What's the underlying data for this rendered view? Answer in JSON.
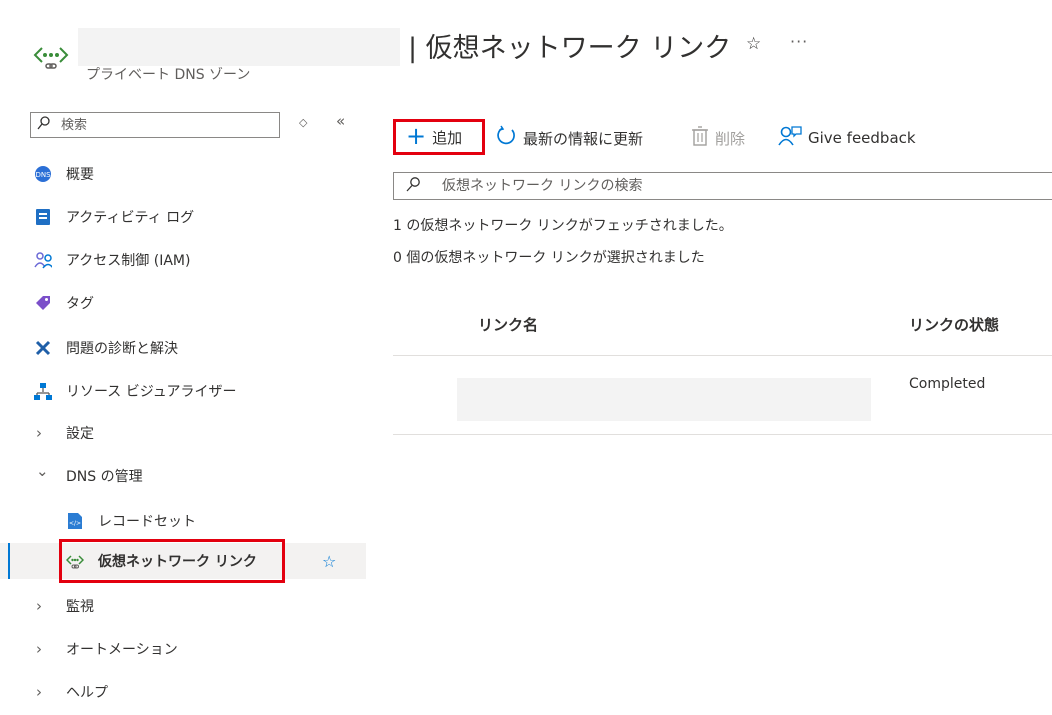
{
  "header": {
    "title": "| 仮想ネットワーク リンク",
    "subtitle": "プライベート DNS ゾーン",
    "star_glyph": "☆",
    "more_glyph": "···"
  },
  "sidebar": {
    "search_placeholder": "検索",
    "gear_glyph": "◇",
    "collapse_glyph": "«",
    "items": [
      {
        "label": "概要",
        "icon": "overview-icon"
      },
      {
        "label": "アクティビティ ログ",
        "icon": "activity-log-icon"
      },
      {
        "label": "アクセス制御 (IAM)",
        "icon": "iam-icon"
      },
      {
        "label": "タグ",
        "icon": "tag-icon"
      },
      {
        "label": "問題の診断と解決",
        "icon": "diagnose-icon"
      },
      {
        "label": "リソース ビジュアライザー",
        "icon": "resource-visualizer-icon"
      },
      {
        "label": "設定",
        "chevron": "›"
      },
      {
        "label": "DNS の管理",
        "chevron": "⌄"
      },
      {
        "label": "レコードセット",
        "icon": "record-set-icon"
      },
      {
        "label": "仮想ネットワーク リンク",
        "icon": "virtual-network-link-icon",
        "favorite": "☆"
      },
      {
        "label": "監視",
        "chevron": "›"
      },
      {
        "label": "オートメーション",
        "chevron": "›"
      },
      {
        "label": "ヘルプ",
        "chevron": "›"
      }
    ]
  },
  "toolbar": {
    "add_label": "追加",
    "add_glyph": "+",
    "refresh_label": "最新の情報に更新",
    "delete_label": "削除",
    "feedback_label": "Give feedback"
  },
  "main": {
    "search_placeholder": "仮想ネットワーク リンクの検索",
    "fetched_text": "1 の仮想ネットワーク リンクがフェッチされました。",
    "selected_text": "0 個の仮想ネットワーク リンクが選択されました"
  },
  "table": {
    "columns": [
      "リンク名",
      "リンクの状態"
    ],
    "rows": [
      {
        "name": "",
        "status": "Completed"
      }
    ]
  },
  "colors": {
    "accent": "#0078d4",
    "highlight_box": "#e3000f"
  }
}
